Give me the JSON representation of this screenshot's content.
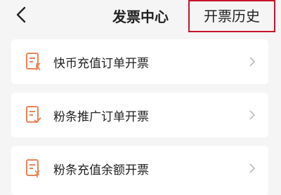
{
  "header": {
    "title": "发票中心",
    "history_label": "开票历史",
    "back_icon": "chevron-left-icon",
    "highlight_color": "#c8142a"
  },
  "items": [
    {
      "label": "快币充值订单开票",
      "icon": "invoice-k-icon"
    },
    {
      "label": "粉条推广订单开票",
      "icon": "invoice-check-icon"
    },
    {
      "label": "粉条充值余额开票",
      "icon": "invoice-yen-icon"
    }
  ],
  "colors": {
    "accent": "#e8845a",
    "background": "#f5f5f5",
    "card": "#ffffff"
  }
}
